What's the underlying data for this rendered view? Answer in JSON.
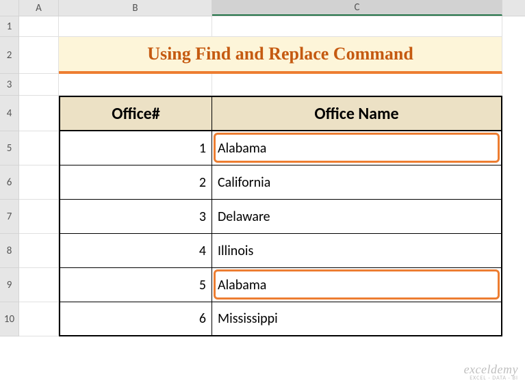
{
  "columns": {
    "A": "A",
    "B": "B",
    "C": "C"
  },
  "rows": [
    "1",
    "2",
    "3",
    "4",
    "5",
    "6",
    "7",
    "8",
    "9",
    "10"
  ],
  "title": "Using Find and Replace Command",
  "table": {
    "headers": {
      "office_num": "Office#",
      "office_name": "Office Name"
    },
    "data": [
      {
        "num": "1",
        "name": "Alabama"
      },
      {
        "num": "2",
        "name": "California"
      },
      {
        "num": "3",
        "name": "Delaware"
      },
      {
        "num": "4",
        "name": "Illinois"
      },
      {
        "num": "5",
        "name": "Alabama"
      },
      {
        "num": "6",
        "name": "Mississippi"
      }
    ]
  },
  "watermark": {
    "line1": "exceldemy",
    "line2": "EXCEL · DATA · BI"
  },
  "active_column": "C",
  "chart_data": {
    "type": "table",
    "title": "Using Find and Replace Command",
    "columns": [
      "Office#",
      "Office Name"
    ],
    "rows": [
      [
        1,
        "Alabama"
      ],
      [
        2,
        "California"
      ],
      [
        3,
        "Delaware"
      ],
      [
        4,
        "Illinois"
      ],
      [
        5,
        "Alabama"
      ],
      [
        6,
        "Mississippi"
      ]
    ],
    "highlighted_rows": [
      0,
      4
    ]
  }
}
